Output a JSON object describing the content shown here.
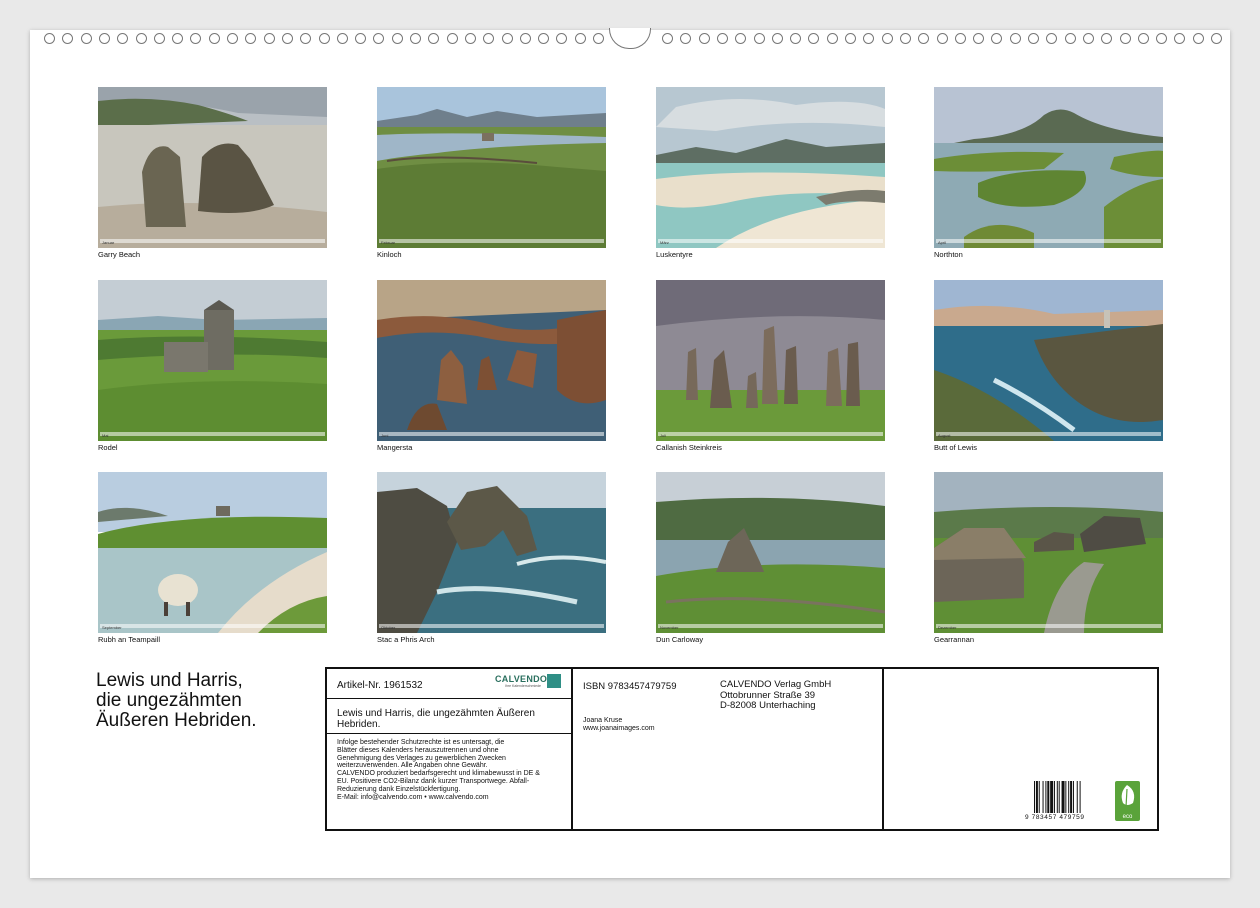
{
  "photos": [
    {
      "caption": "Garry Beach",
      "month": "Januar"
    },
    {
      "caption": "Kinloch",
      "month": "Februar"
    },
    {
      "caption": "Luskentyre",
      "month": "März"
    },
    {
      "caption": "Northton",
      "month": "April"
    },
    {
      "caption": "Rodel",
      "month": "Mai"
    },
    {
      "caption": "Mangersta",
      "month": "Juni"
    },
    {
      "caption": "Callanish Steinkreis",
      "month": "Juli"
    },
    {
      "caption": "Butt of Lewis",
      "month": "August"
    },
    {
      "caption": "Rubh an Teampaill",
      "month": "September"
    },
    {
      "caption": "Stac a Phris Arch",
      "month": "Oktober"
    },
    {
      "caption": "Dun Carloway",
      "month": "November"
    },
    {
      "caption": "Gearrannan",
      "month": "Dezember"
    }
  ],
  "title": {
    "line1": "Lewis und Harris,",
    "line2": "die ungezähmten",
    "line3": "Äußeren Hebriden."
  },
  "info": {
    "article": "Artikel-Nr. 1961532",
    "brand": "CALVENDO",
    "brand_sub": "Ihre Kalenderschmiede",
    "book_title": "Lewis und Harris, die ungezähmten Äußeren Hebriden.",
    "legal": [
      "Infolge bestehender Schutzrechte ist es untersagt, die",
      "Blätter dieses Kalenders herauszutrennen und ohne",
      "Genehmigung des Verlages zu gewerblichen Zwecken",
      "weiterzuverwenden. Alle Angaben ohne Gewähr.",
      "CALVENDO produziert bedarfsgerecht und klimabewusst in DE &",
      "EU. Positivere CO2-Bilanz dank kurzer Transportwege. Abfall-",
      "Reduzierung dank Einzelstückfertigung.",
      "E-Mail: info@calvendo.com • www.calvendo.com"
    ],
    "isbn": "ISBN 9783457479759",
    "publisher": [
      "CALVENDO Verlag GmbH",
      "Ottobrunner Straße 39",
      "D-82008 Unterhaching"
    ],
    "author": "Joana Kruse",
    "website": "www.joanaimages.com",
    "barcode_digits": "9 783457 479759",
    "eco_label": "eco"
  }
}
